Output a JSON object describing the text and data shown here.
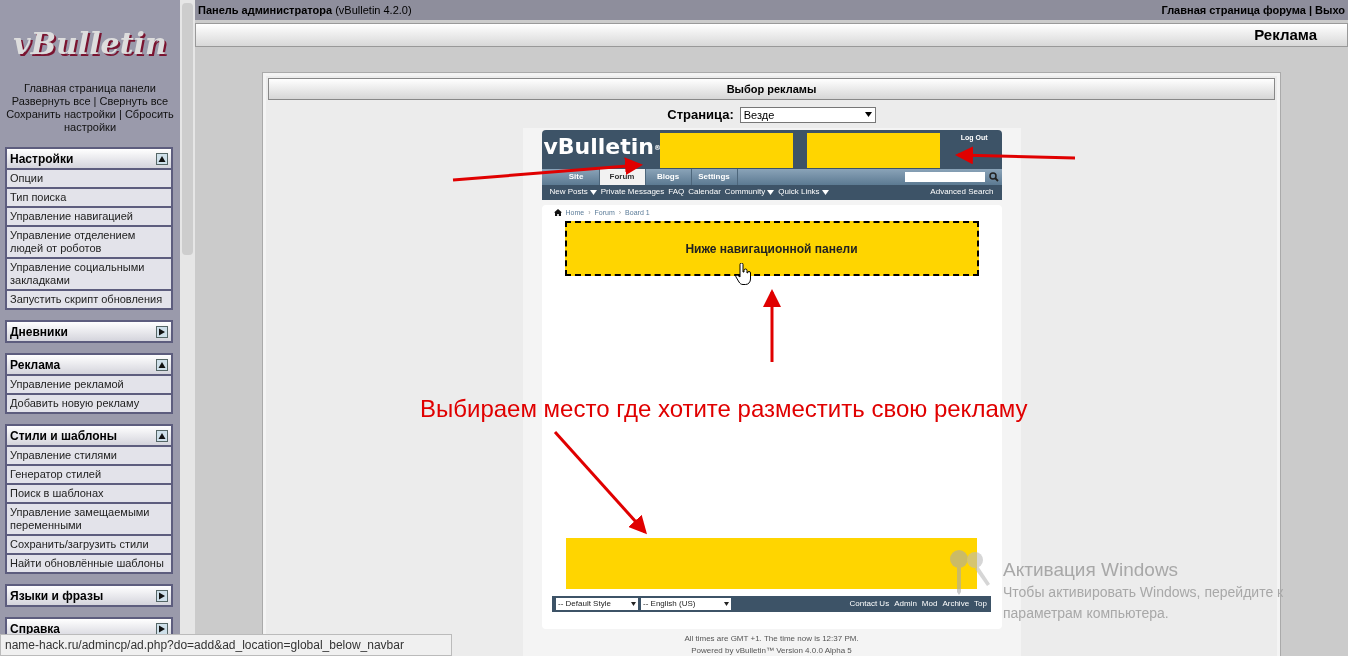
{
  "top_bar": {
    "title": "Панель администратора",
    "version": "(vBulletin 4.2.0)",
    "right_links": "Главная страница форума | Выхо"
  },
  "sidebar": {
    "logo": "vBulletin",
    "links": [
      "Главная страница панели",
      "Развернуть все | Свернуть все",
      "Сохранить настройки | Сбросить настройки"
    ],
    "sections": [
      {
        "title": "Настройки",
        "expanded": true,
        "items": [
          "Опции",
          "Тип поиска",
          "Управление навигацией",
          "Управление отделением людей от роботов",
          "Управление социальными закладками",
          "Запустить скрипт обновления"
        ]
      },
      {
        "title": "Дневники",
        "expanded": false
      },
      {
        "title": "Реклама",
        "expanded": true,
        "items": [
          "Управление рекламой",
          "Добавить новую рекламу"
        ]
      },
      {
        "title": "Стили и шаблоны",
        "expanded": true,
        "items": [
          "Управление стилями",
          "Генератор стилей",
          "Поиск в шаблонах",
          "Управление замещаемыми переменными",
          "Сохранить/загрузить стили",
          "Найти обновлённые шаблоны"
        ]
      },
      {
        "title": "Языки и фразы",
        "expanded": false
      },
      {
        "title": "Справка",
        "expanded": false
      }
    ]
  },
  "page_title": "Реклама",
  "panel": {
    "title": "Выбор рекламы",
    "page_label": "Страница:",
    "page_value": "Везде",
    "preview": {
      "logo": "vBulletin",
      "logo_mark": "®",
      "logout": "Log Out",
      "tabs": [
        {
          "label": "Site",
          "selected": false
        },
        {
          "label": "Forum",
          "selected": true
        },
        {
          "label": "Blogs",
          "selected": false
        },
        {
          "label": "Settings",
          "selected": false
        }
      ],
      "subnav": [
        {
          "label": "New Posts",
          "menu": true
        },
        {
          "label": "Private Messages",
          "menu": false
        },
        {
          "label": "FAQ",
          "menu": false
        },
        {
          "label": "Calendar",
          "menu": false
        },
        {
          "label": "Community",
          "menu": true
        },
        {
          "label": "Quick Links",
          "menu": true
        }
      ],
      "advanced_search": "Advanced Search",
      "breadcrumb": [
        {
          "kind": "link",
          "text": "Home"
        },
        {
          "kind": "separator",
          "text": "›"
        },
        {
          "kind": "link",
          "text": "Forum"
        },
        {
          "kind": "separator",
          "text": "›"
        },
        {
          "kind": "link",
          "text": "Board 1"
        }
      ],
      "ad_slot_label": "Ниже навигационной панели",
      "style_select": "-- Default Style",
      "language_select": "-- English (US)",
      "footer_links": [
        "Contact Us",
        "Admin",
        "Mod",
        "Archive",
        "Top"
      ],
      "time_note": "All times are GMT +1. The time now is 12:37 PM.",
      "powered_note": "Powered by vBulletin™ Version 4.0.0 Alpha 5"
    }
  },
  "annotation": "Выбираем место где хотите разместить свою рекламу",
  "windows_activation": {
    "title": "Активация Windows",
    "text": "Чтобы активировать Windows, перейдите к параметрам компьютера."
  },
  "status_bar": "name-hack.ru/admincp/ad.php?do=add&ad_location=global_below_navbar"
}
